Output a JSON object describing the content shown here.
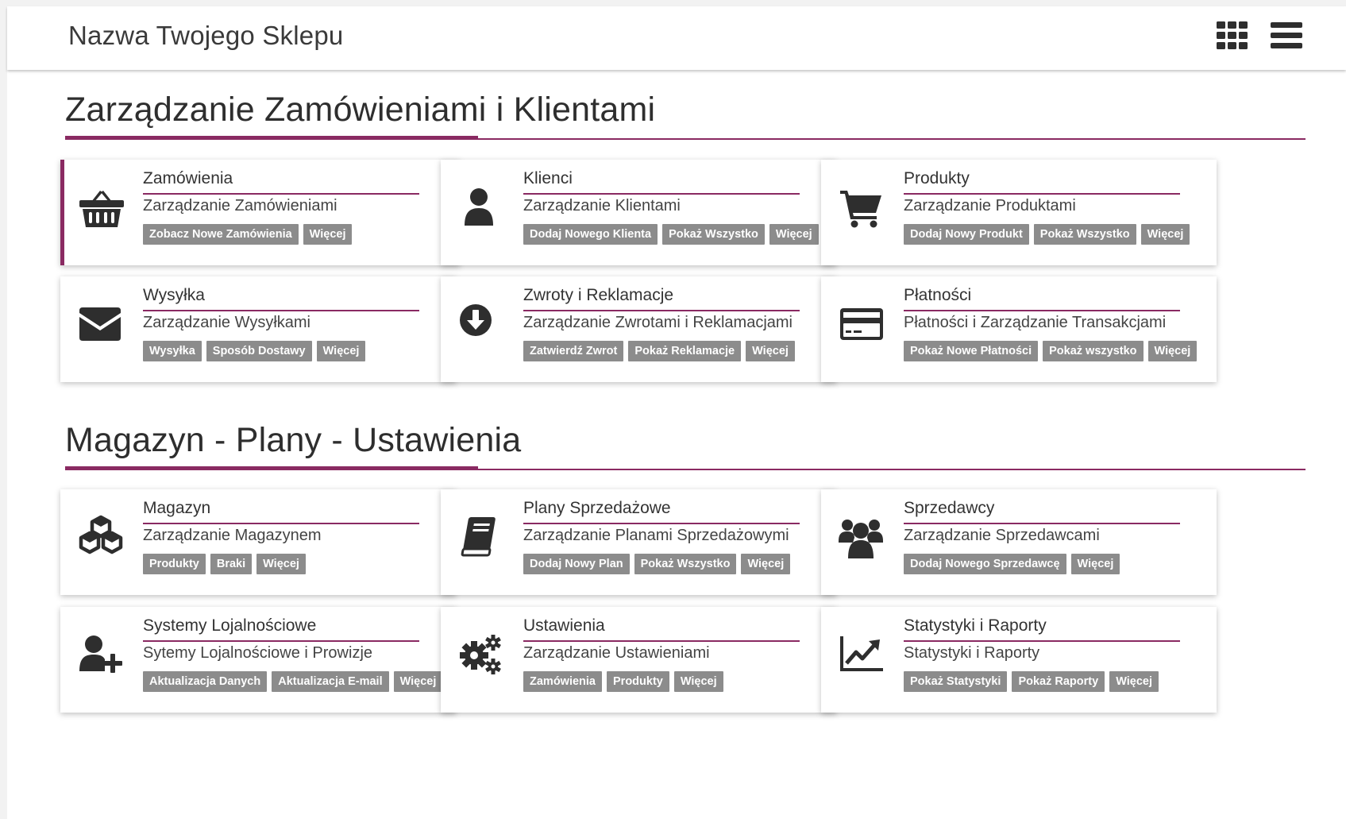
{
  "header": {
    "shop_name": "Nazwa Twojego Sklepu",
    "icons": [
      "grid-icon",
      "menu-icon"
    ]
  },
  "colors": {
    "accent": "#8a2a62",
    "button_bg": "#8c8c8c",
    "icon": "#2e2e2e"
  },
  "sections": [
    {
      "title": "Zarządzanie Zamówieniami i Klientami",
      "cards": [
        {
          "icon": "basket-icon",
          "title": "Zamówienia",
          "subtitle": "Zarządzanie Zamówieniami",
          "buttons": [
            "Zobacz Nowe Zamówienia",
            "Więcej"
          ],
          "active": true
        },
        {
          "icon": "user-icon",
          "title": "Klienci",
          "subtitle": "Zarządzanie Klientami",
          "buttons": [
            "Dodaj Nowego Klienta",
            "Pokaż Wszystko",
            "Więcej"
          ]
        },
        {
          "icon": "cart-icon",
          "title": "Produkty",
          "subtitle": "Zarządzanie Produktami",
          "buttons": [
            "Dodaj Nowy Produkt",
            "Pokaż Wszystko",
            "Więcej"
          ]
        },
        {
          "icon": "envelope-icon",
          "title": "Wysyłka",
          "subtitle": "Zarządzanie Wysyłkami",
          "buttons": [
            "Wysyłka",
            "Sposób Dostawy",
            "Więcej"
          ]
        },
        {
          "icon": "arrow-circle-down-icon",
          "title": "Zwroty i Reklamacje",
          "subtitle": "Zarządzanie Zwrotami i Reklamacjami",
          "buttons": [
            "Zatwierdź Zwrot",
            "Pokaż Reklamacje",
            "Więcej"
          ]
        },
        {
          "icon": "credit-card-icon",
          "title": "Płatności",
          "subtitle": "Płatności i Zarządzanie Transakcjami",
          "buttons": [
            "Pokaż Nowe Płatności",
            "Pokaż wszystko",
            "Więcej"
          ]
        }
      ]
    },
    {
      "title": "Magazyn - Plany - Ustawienia",
      "cards": [
        {
          "icon": "cubes-icon",
          "title": "Magazyn",
          "subtitle": "Zarządzanie Magazynem",
          "buttons": [
            "Produkty",
            "Braki",
            "Więcej"
          ]
        },
        {
          "icon": "book-icon",
          "title": "Plany Sprzedażowe",
          "subtitle": "Zarządzanie Planami Sprzedażowymi",
          "buttons": [
            "Dodaj Nowy Plan",
            "Pokaż Wszystko",
            "Więcej"
          ]
        },
        {
          "icon": "users-icon",
          "title": "Sprzedawcy",
          "subtitle": "Zarządzanie Sprzedawcami",
          "buttons": [
            "Dodaj Nowego Sprzedawcę",
            "Więcej"
          ]
        },
        {
          "icon": "user-plus-icon",
          "title": "Systemy Lojalnościowe",
          "subtitle": "Sytemy Lojalnościowe i Prowizje",
          "buttons": [
            "Aktualizacja Danych",
            "Aktualizacja E-mail",
            "Więcej"
          ]
        },
        {
          "icon": "gears-icon",
          "title": "Ustawienia",
          "subtitle": "Zarządzanie Ustawieniami",
          "buttons": [
            "Zamówienia",
            "Produkty",
            "Więcej"
          ]
        },
        {
          "icon": "line-chart-icon",
          "title": "Statystyki i Raporty",
          "subtitle": "Statystyki i Raporty",
          "buttons": [
            "Pokaż Statystyki",
            "Pokaż Raporty",
            "Więcej"
          ]
        }
      ]
    }
  ]
}
